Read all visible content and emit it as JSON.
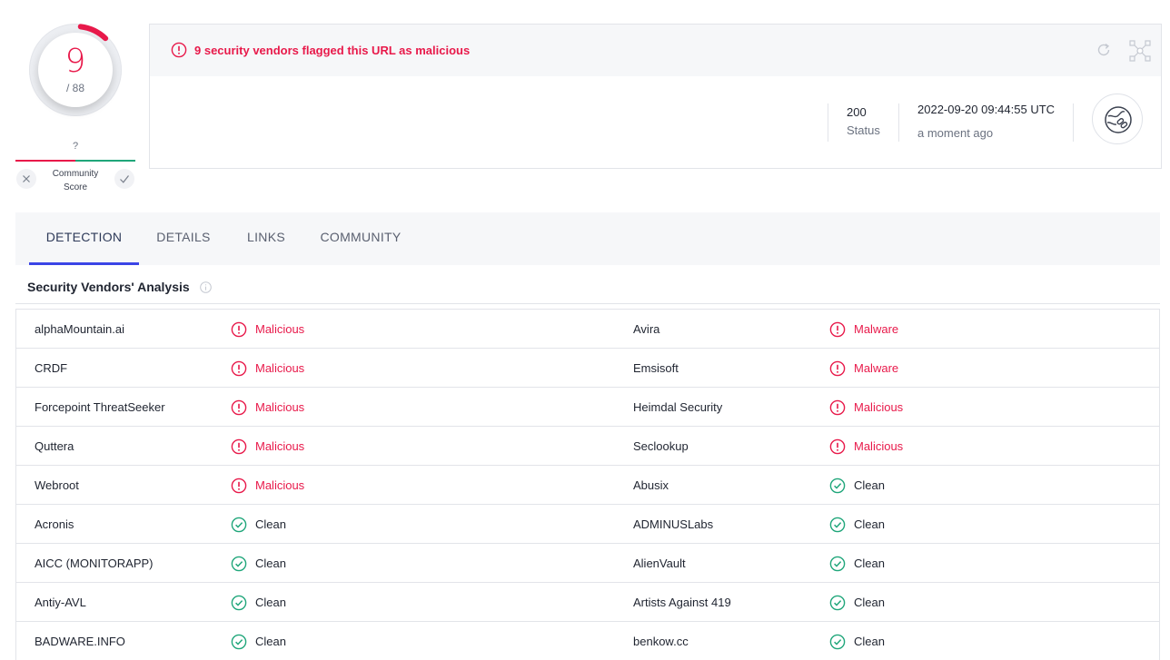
{
  "score": {
    "detections": "9",
    "total": "/ 88",
    "detection_ratio": 0.102
  },
  "community": {
    "question": "?",
    "label": "Community Score"
  },
  "alert": {
    "text": "9 security vendors flagged this URL as malicious"
  },
  "stats": {
    "status_code": "200",
    "status_label": "Status",
    "date": "2022-09-20 09:44:55 UTC",
    "ago": "a moment ago"
  },
  "tabs": [
    {
      "label": "DETECTION"
    },
    {
      "label": "DETAILS"
    },
    {
      "label": "LINKS"
    },
    {
      "label": "COMMUNITY"
    }
  ],
  "section": {
    "title": "Security Vendors' Analysis"
  },
  "colors": {
    "malicious": "#e8194a",
    "clean": "#1fa67a",
    "tab_active": "#3b45e6"
  },
  "rows": [
    {
      "left": {
        "vendor": "alphaMountain.ai",
        "result": "Malicious",
        "status": "bad"
      },
      "right": {
        "vendor": "Avira",
        "result": "Malware",
        "status": "bad"
      }
    },
    {
      "left": {
        "vendor": "CRDF",
        "result": "Malicious",
        "status": "bad"
      },
      "right": {
        "vendor": "Emsisoft",
        "result": "Malware",
        "status": "bad"
      }
    },
    {
      "left": {
        "vendor": "Forcepoint ThreatSeeker",
        "result": "Malicious",
        "status": "bad"
      },
      "right": {
        "vendor": "Heimdal Security",
        "result": "Malicious",
        "status": "bad"
      }
    },
    {
      "left": {
        "vendor": "Quttera",
        "result": "Malicious",
        "status": "bad"
      },
      "right": {
        "vendor": "Seclookup",
        "result": "Malicious",
        "status": "bad"
      }
    },
    {
      "left": {
        "vendor": "Webroot",
        "result": "Malicious",
        "status": "bad"
      },
      "right": {
        "vendor": "Abusix",
        "result": "Clean",
        "status": "good"
      }
    },
    {
      "left": {
        "vendor": "Acronis",
        "result": "Clean",
        "status": "good"
      },
      "right": {
        "vendor": "ADMINUSLabs",
        "result": "Clean",
        "status": "good"
      }
    },
    {
      "left": {
        "vendor": "AICC (MONITORAPP)",
        "result": "Clean",
        "status": "good"
      },
      "right": {
        "vendor": "AlienVault",
        "result": "Clean",
        "status": "good"
      }
    },
    {
      "left": {
        "vendor": "Antiy-AVL",
        "result": "Clean",
        "status": "good"
      },
      "right": {
        "vendor": "Artists Against 419",
        "result": "Clean",
        "status": "good"
      }
    },
    {
      "left": {
        "vendor": "BADWARE.INFO",
        "result": "Clean",
        "status": "good"
      },
      "right": {
        "vendor": "benkow.cc",
        "result": "Clean",
        "status": "good"
      }
    }
  ]
}
